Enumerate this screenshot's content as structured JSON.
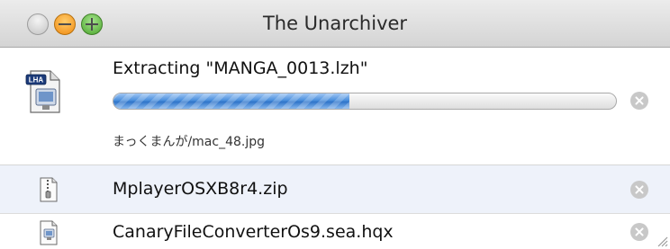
{
  "window": {
    "title": "The Unarchiver"
  },
  "active_task": {
    "icon": "lha-archive-icon",
    "icon_badge": "LHA",
    "title": "Extracting \"MANGA_0013.lzh\"",
    "progress": 0.47,
    "current_file": "まっくまんが/mac_48.jpg"
  },
  "queue": [
    {
      "name": "MplayerOSXB8r4.zip",
      "icon": "zip-archive-icon"
    },
    {
      "name": "CanaryFileConverterOs9.sea.hqx",
      "icon": "hqx-archive-icon"
    }
  ],
  "colors": {
    "progress_fill": "#3d85d8",
    "queued_row_highlight": "#eef2fa",
    "cancel_button": "#c8c8c8"
  }
}
